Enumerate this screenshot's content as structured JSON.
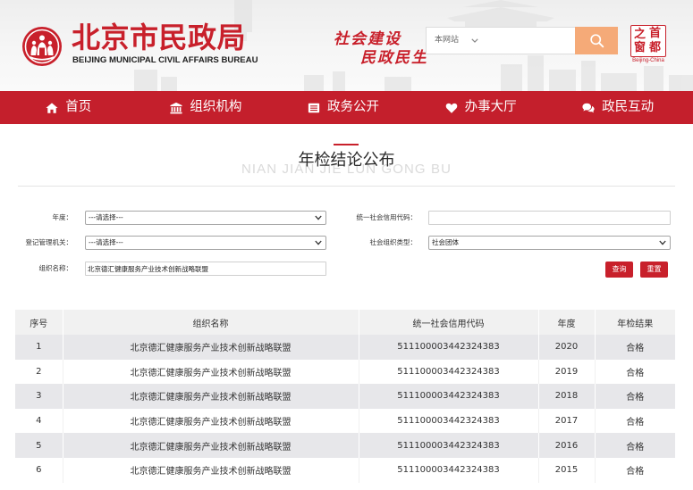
{
  "colors": {
    "brand_red": "#c8202b",
    "nav_red": "#c41f2c",
    "search_button": "#f5aa78",
    "table_header_bg": "#f1f1f1",
    "table_stripe_bg": "#e7e7ea"
  },
  "header": {
    "emblem_icon": "civil-affairs-emblem-icon",
    "logo_cn": "北京市民政局",
    "logo_en": "BEIJING MUNICIPAL CIVIL AFFAIRS BUREAU",
    "slogan": [
      "社会建设",
      "民政民生"
    ],
    "search": {
      "scope_label": "本网站",
      "scope_icon": "chevron-down-icon",
      "button_icon": "search-icon"
    },
    "portal_logo": {
      "chars": [
        "首",
        "都",
        "之",
        "窗"
      ],
      "en": "Beijing-China"
    }
  },
  "nav": {
    "items": [
      {
        "label": "首页",
        "icon": "home-icon"
      },
      {
        "label": "组织机构",
        "icon": "institution-icon"
      },
      {
        "label": "政务公开",
        "icon": "list-icon"
      },
      {
        "label": "办事大厅",
        "icon": "heart-icon"
      },
      {
        "label": "政民互动",
        "icon": "comments-icon"
      }
    ]
  },
  "page": {
    "title": "年检结论公布",
    "title_pinyin": "NIAN JIAN JIE LUN GONG BU"
  },
  "form": {
    "year": {
      "label": "年度：",
      "value": "---请选择---"
    },
    "credit_code": {
      "label": "统一社会信用代码：",
      "value": ""
    },
    "registry": {
      "label": "登记管理机关：",
      "value": "---请选择---"
    },
    "org_type": {
      "label": "社会组织类型：",
      "value": "社会团体"
    },
    "org_name": {
      "label": "组织名称：",
      "value": "北京德汇健康服务产业技术创新战略联盟"
    },
    "query_button": "查询",
    "reset_button": "重置"
  },
  "table": {
    "headers": [
      "序号",
      "组织名称",
      "统一社会信用代码",
      "年度",
      "年检结果"
    ],
    "rows": [
      {
        "seq": "1",
        "name": "北京德汇健康服务产业技术创新战略联盟",
        "code": "511100003442324383",
        "year": "2020",
        "result": "合格"
      },
      {
        "seq": "2",
        "name": "北京德汇健康服务产业技术创新战略联盟",
        "code": "511100003442324383",
        "year": "2019",
        "result": "合格"
      },
      {
        "seq": "3",
        "name": "北京德汇健康服务产业技术创新战略联盟",
        "code": "511100003442324383",
        "year": "2018",
        "result": "合格"
      },
      {
        "seq": "4",
        "name": "北京德汇健康服务产业技术创新战略联盟",
        "code": "511100003442324383",
        "year": "2017",
        "result": "合格"
      },
      {
        "seq": "5",
        "name": "北京德汇健康服务产业技术创新战略联盟",
        "code": "511100003442324383",
        "year": "2016",
        "result": "合格"
      },
      {
        "seq": "6",
        "name": "北京德汇健康服务产业技术创新战略联盟",
        "code": "511100003442324383",
        "year": "2015",
        "result": "合格"
      }
    ]
  }
}
